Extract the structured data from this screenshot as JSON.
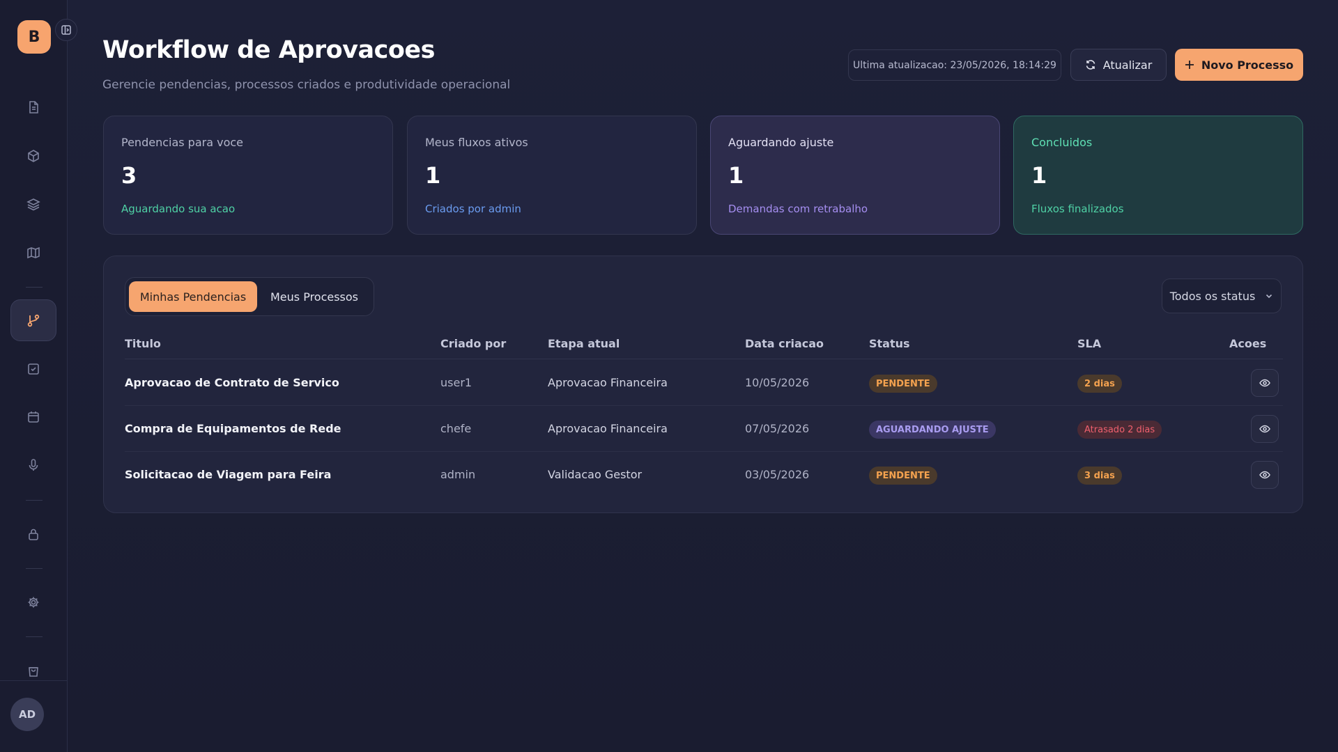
{
  "sidebar": {
    "logo_letter": "B",
    "user_initials": "AD",
    "icons": [
      "document-icon",
      "package-icon",
      "layers-icon",
      "map-icon",
      "git-branch-icon",
      "checkbox-icon",
      "calendar-icon",
      "microphone-icon",
      "lock-icon",
      "gear-icon",
      "shopping-bag-icon"
    ]
  },
  "header": {
    "title": "Workflow de Aprovacoes",
    "subtitle": "Gerencie pendencias, processos criados e produtividade operacional",
    "last_update": "Ultima atualizacao: 23/05/2026, 18:14:29",
    "refresh_label": "Atualizar",
    "new_process_label": "Novo Processo"
  },
  "stats": [
    {
      "label": "Pendencias para voce",
      "value": "3",
      "hint": "Aguardando sua acao",
      "hint_color": "#4fd1a5"
    },
    {
      "label": "Meus fluxos ativos",
      "value": "1",
      "hint": "Criados por admin",
      "hint_color": "#6b9cf0"
    },
    {
      "label": "Aguardando ajuste",
      "value": "1",
      "hint": "Demandas com retrabalho",
      "hint_color": "#a58ef0"
    },
    {
      "label": "Concluidos",
      "value": "1",
      "hint": "Fluxos finalizados",
      "hint_color": "#4fd1a5"
    }
  ],
  "tabs": {
    "active": "Minhas Pendencias",
    "inactive": "Meus Processos"
  },
  "filter": {
    "status_value": "Todos os status"
  },
  "table": {
    "columns": [
      "Titulo",
      "Criado por",
      "Etapa atual",
      "Data criacao",
      "Status",
      "SLA",
      "Acoes"
    ],
    "rows": [
      {
        "titulo": "Aprovacao de Contrato de Servico",
        "criado_por": "user1",
        "etapa": "Aprovacao Financeira",
        "data": "10/05/2026",
        "status": "PENDENTE",
        "sla": "2 dias"
      },
      {
        "titulo": "Compra de Equipamentos de Rede",
        "criado_por": "chefe",
        "etapa": "Aprovacao Financeira",
        "data": "07/05/2026",
        "status": "AGUARDANDO AJUSTE",
        "sla": "Atrasado 2 dias"
      },
      {
        "titulo": "Solicitacao de Viagem para Feira",
        "criado_por": "admin",
        "etapa": "Validacao Gestor",
        "data": "03/05/2026",
        "status": "PENDENTE",
        "sla": "3 dias"
      }
    ]
  },
  "colors": {
    "accent": "#f6a56f",
    "pending_bg": "#4a3a2c",
    "pending_fg": "#f4a24f",
    "adjust_bg": "#3b3764",
    "adjust_fg": "#a99cf0",
    "late_bg": "#4a2a35",
    "late_fg": "#f0606e"
  }
}
